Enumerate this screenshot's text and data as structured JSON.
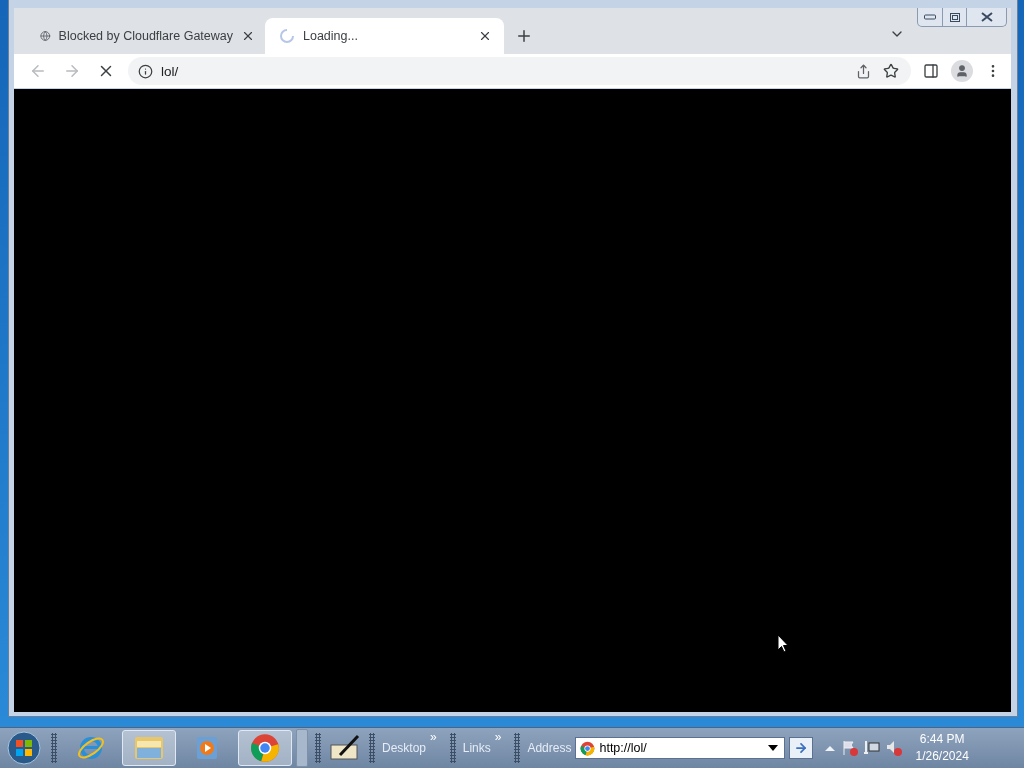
{
  "tabs": [
    {
      "title": "Blocked by Cloudflare Gateway",
      "selected": false,
      "loading": false
    },
    {
      "title": "Loading...",
      "selected": true,
      "loading": true
    }
  ],
  "toolbar": {
    "url": "lol/",
    "loading": true
  },
  "taskbar": {
    "apps": [
      {
        "kind": "ie",
        "active": false
      },
      {
        "kind": "folder",
        "active": true
      },
      {
        "kind": "media",
        "active": false
      },
      {
        "kind": "chrome",
        "active": true
      }
    ],
    "toolbars": [
      {
        "label": "Desktop",
        "more": "»"
      },
      {
        "label": "Links",
        "more": "»"
      }
    ],
    "address": {
      "label": "Address",
      "value": "http://lol/"
    },
    "clock": {
      "time": "6:44 PM",
      "date": "1/26/2024"
    }
  }
}
